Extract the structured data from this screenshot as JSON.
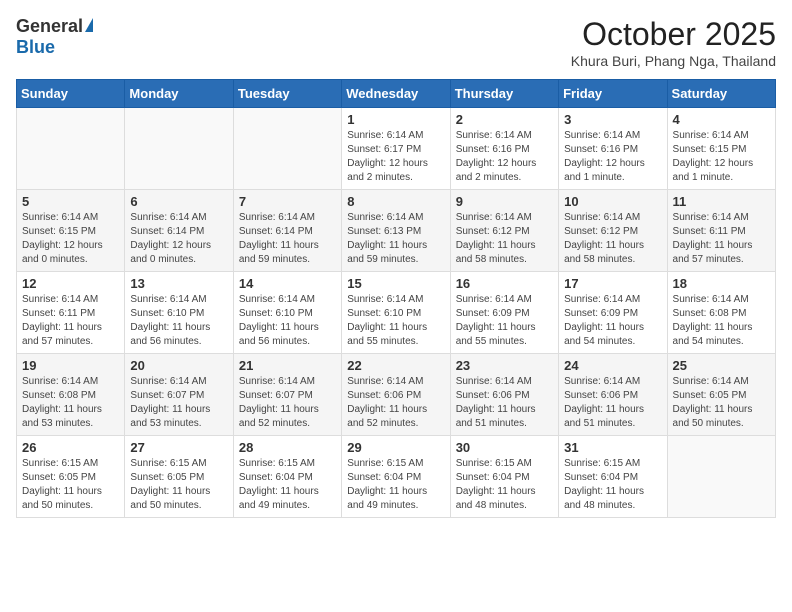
{
  "header": {
    "logo_general": "General",
    "logo_blue": "Blue",
    "month": "October 2025",
    "location": "Khura Buri, Phang Nga, Thailand"
  },
  "weekdays": [
    "Sunday",
    "Monday",
    "Tuesday",
    "Wednesday",
    "Thursday",
    "Friday",
    "Saturday"
  ],
  "weeks": [
    [
      {
        "day": "",
        "content": ""
      },
      {
        "day": "",
        "content": ""
      },
      {
        "day": "",
        "content": ""
      },
      {
        "day": "1",
        "content": "Sunrise: 6:14 AM\nSunset: 6:17 PM\nDaylight: 12 hours and 2 minutes."
      },
      {
        "day": "2",
        "content": "Sunrise: 6:14 AM\nSunset: 6:16 PM\nDaylight: 12 hours and 2 minutes."
      },
      {
        "day": "3",
        "content": "Sunrise: 6:14 AM\nSunset: 6:16 PM\nDaylight: 12 hours and 1 minute."
      },
      {
        "day": "4",
        "content": "Sunrise: 6:14 AM\nSunset: 6:15 PM\nDaylight: 12 hours and 1 minute."
      }
    ],
    [
      {
        "day": "5",
        "content": "Sunrise: 6:14 AM\nSunset: 6:15 PM\nDaylight: 12 hours and 0 minutes."
      },
      {
        "day": "6",
        "content": "Sunrise: 6:14 AM\nSunset: 6:14 PM\nDaylight: 12 hours and 0 minutes."
      },
      {
        "day": "7",
        "content": "Sunrise: 6:14 AM\nSunset: 6:14 PM\nDaylight: 11 hours and 59 minutes."
      },
      {
        "day": "8",
        "content": "Sunrise: 6:14 AM\nSunset: 6:13 PM\nDaylight: 11 hours and 59 minutes."
      },
      {
        "day": "9",
        "content": "Sunrise: 6:14 AM\nSunset: 6:12 PM\nDaylight: 11 hours and 58 minutes."
      },
      {
        "day": "10",
        "content": "Sunrise: 6:14 AM\nSunset: 6:12 PM\nDaylight: 11 hours and 58 minutes."
      },
      {
        "day": "11",
        "content": "Sunrise: 6:14 AM\nSunset: 6:11 PM\nDaylight: 11 hours and 57 minutes."
      }
    ],
    [
      {
        "day": "12",
        "content": "Sunrise: 6:14 AM\nSunset: 6:11 PM\nDaylight: 11 hours and 57 minutes."
      },
      {
        "day": "13",
        "content": "Sunrise: 6:14 AM\nSunset: 6:10 PM\nDaylight: 11 hours and 56 minutes."
      },
      {
        "day": "14",
        "content": "Sunrise: 6:14 AM\nSunset: 6:10 PM\nDaylight: 11 hours and 56 minutes."
      },
      {
        "day": "15",
        "content": "Sunrise: 6:14 AM\nSunset: 6:10 PM\nDaylight: 11 hours and 55 minutes."
      },
      {
        "day": "16",
        "content": "Sunrise: 6:14 AM\nSunset: 6:09 PM\nDaylight: 11 hours and 55 minutes."
      },
      {
        "day": "17",
        "content": "Sunrise: 6:14 AM\nSunset: 6:09 PM\nDaylight: 11 hours and 54 minutes."
      },
      {
        "day": "18",
        "content": "Sunrise: 6:14 AM\nSunset: 6:08 PM\nDaylight: 11 hours and 54 minutes."
      }
    ],
    [
      {
        "day": "19",
        "content": "Sunrise: 6:14 AM\nSunset: 6:08 PM\nDaylight: 11 hours and 53 minutes."
      },
      {
        "day": "20",
        "content": "Sunrise: 6:14 AM\nSunset: 6:07 PM\nDaylight: 11 hours and 53 minutes."
      },
      {
        "day": "21",
        "content": "Sunrise: 6:14 AM\nSunset: 6:07 PM\nDaylight: 11 hours and 52 minutes."
      },
      {
        "day": "22",
        "content": "Sunrise: 6:14 AM\nSunset: 6:06 PM\nDaylight: 11 hours and 52 minutes."
      },
      {
        "day": "23",
        "content": "Sunrise: 6:14 AM\nSunset: 6:06 PM\nDaylight: 11 hours and 51 minutes."
      },
      {
        "day": "24",
        "content": "Sunrise: 6:14 AM\nSunset: 6:06 PM\nDaylight: 11 hours and 51 minutes."
      },
      {
        "day": "25",
        "content": "Sunrise: 6:14 AM\nSunset: 6:05 PM\nDaylight: 11 hours and 50 minutes."
      }
    ],
    [
      {
        "day": "26",
        "content": "Sunrise: 6:15 AM\nSunset: 6:05 PM\nDaylight: 11 hours and 50 minutes."
      },
      {
        "day": "27",
        "content": "Sunrise: 6:15 AM\nSunset: 6:05 PM\nDaylight: 11 hours and 50 minutes."
      },
      {
        "day": "28",
        "content": "Sunrise: 6:15 AM\nSunset: 6:04 PM\nDaylight: 11 hours and 49 minutes."
      },
      {
        "day": "29",
        "content": "Sunrise: 6:15 AM\nSunset: 6:04 PM\nDaylight: 11 hours and 49 minutes."
      },
      {
        "day": "30",
        "content": "Sunrise: 6:15 AM\nSunset: 6:04 PM\nDaylight: 11 hours and 48 minutes."
      },
      {
        "day": "31",
        "content": "Sunrise: 6:15 AM\nSunset: 6:04 PM\nDaylight: 11 hours and 48 minutes."
      },
      {
        "day": "",
        "content": ""
      }
    ]
  ]
}
